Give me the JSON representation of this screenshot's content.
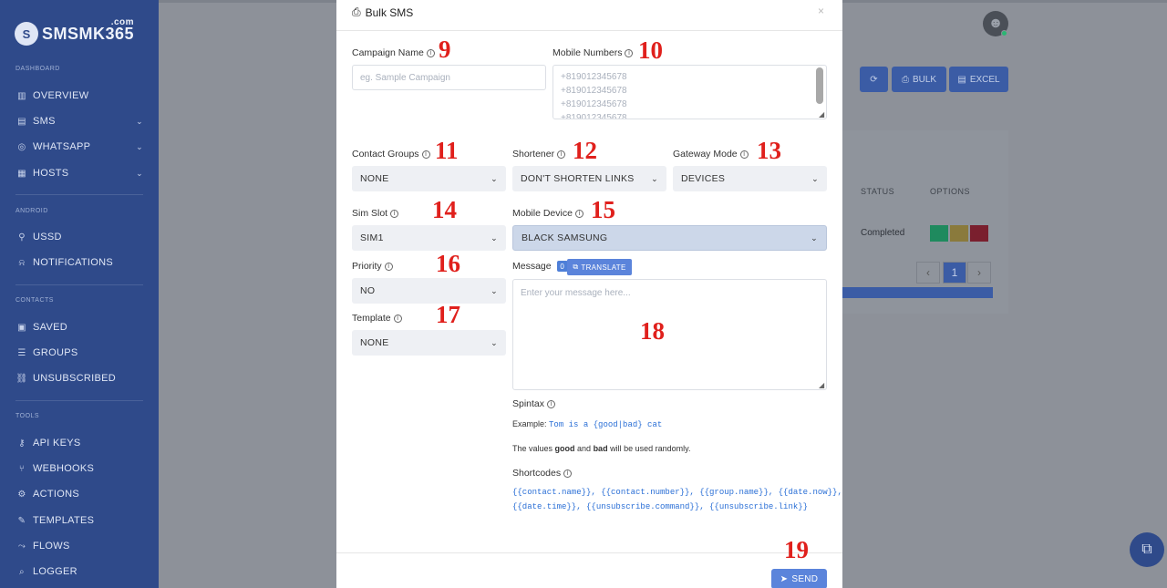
{
  "brand": {
    "logo_letter": "S",
    "name": "SMSMK365",
    "tld": ".com"
  },
  "sidebar": {
    "sections": [
      {
        "label": "DASHBOARD"
      },
      {
        "label": "ANDROID"
      },
      {
        "label": "CONTACTS"
      },
      {
        "label": "TOOLS"
      }
    ],
    "items": [
      {
        "label": "OVERVIEW",
        "icon": "chart-icon"
      },
      {
        "label": "SMS",
        "icon": "message-icon",
        "expandable": true
      },
      {
        "label": "WHATSAPP",
        "icon": "whatsapp-icon",
        "expandable": true
      },
      {
        "label": "HOSTS",
        "icon": "server-icon",
        "expandable": true
      },
      {
        "label": "USSD",
        "icon": "ussd-icon"
      },
      {
        "label": "NOTIFICATIONS",
        "icon": "bell-icon"
      },
      {
        "label": "SAVED",
        "icon": "contacts-icon"
      },
      {
        "label": "GROUPS",
        "icon": "list-icon"
      },
      {
        "label": "UNSUBSCRIBED",
        "icon": "unlink-icon"
      },
      {
        "label": "API KEYS",
        "icon": "key-icon"
      },
      {
        "label": "WEBHOOKS",
        "icon": "webhook-icon"
      },
      {
        "label": "ACTIONS",
        "icon": "actions-icon"
      },
      {
        "label": "TEMPLATES",
        "icon": "template-icon"
      },
      {
        "label": "FLOWS",
        "icon": "flows-icon"
      },
      {
        "label": "LOGGER",
        "icon": "logger-icon"
      }
    ]
  },
  "background": {
    "buttons": [
      {
        "label": "",
        "icon": "refresh-icon"
      },
      {
        "label": "BULK",
        "icon": "bulk-icon"
      },
      {
        "label": "EXCEL",
        "icon": "excel-icon"
      }
    ],
    "table": {
      "headers": [
        "STATUS",
        "OPTIONS"
      ],
      "row_status": "Completed",
      "page": "1"
    }
  },
  "modal": {
    "title": "Bulk SMS",
    "close_label": "×",
    "campaign_name": {
      "label": "Campaign Name",
      "placeholder": "eg. Sample Campaign",
      "value": ""
    },
    "mobile_numbers": {
      "label": "Mobile Numbers",
      "placeholder_lines": [
        "+819012345678",
        "+819012345678",
        "+819012345678",
        "+819012345678"
      ]
    },
    "contact_groups": {
      "label": "Contact Groups",
      "value": "NONE"
    },
    "shortener": {
      "label": "Shortener",
      "value": "DON'T SHORTEN LINKS"
    },
    "gateway_mode": {
      "label": "Gateway Mode",
      "value": "DEVICES"
    },
    "sim_slot": {
      "label": "Sim Slot",
      "value": "SIM1"
    },
    "mobile_device": {
      "label": "Mobile Device",
      "value": "BLACK SAMSUNG"
    },
    "priority": {
      "label": "Priority",
      "value": "NO"
    },
    "template": {
      "label": "Template",
      "value": "NONE"
    },
    "message": {
      "label": "Message",
      "count": "0",
      "translate_label": "TRANSLATE",
      "placeholder": "Enter your message here..."
    },
    "spintax": {
      "label": "Spintax",
      "example_prefix": "Example: ",
      "example_code": "Tom is a {good|bad} cat",
      "values_pre": "The values ",
      "good": "good",
      "values_mid": " and ",
      "bad": "bad",
      "values_post": " will be used randomly."
    },
    "shortcodes": {
      "label": "Shortcodes",
      "line1": "{{contact.name}}, {{contact.number}}, {{group.name}}, {{date.now}},",
      "line2": "{{date.time}}, {{unsubscribe.command}}, {{unsubscribe.link}}"
    },
    "send_label": "SEND"
  },
  "annotations": [
    "9",
    "10",
    "11",
    "12",
    "13",
    "14",
    "15",
    "16",
    "17",
    "18",
    "19"
  ],
  "colors": {
    "sidebar": "#2f4a8a",
    "primary": "#5b84db",
    "annotation": "#e0201c",
    "selected": "#ccd7e9"
  }
}
